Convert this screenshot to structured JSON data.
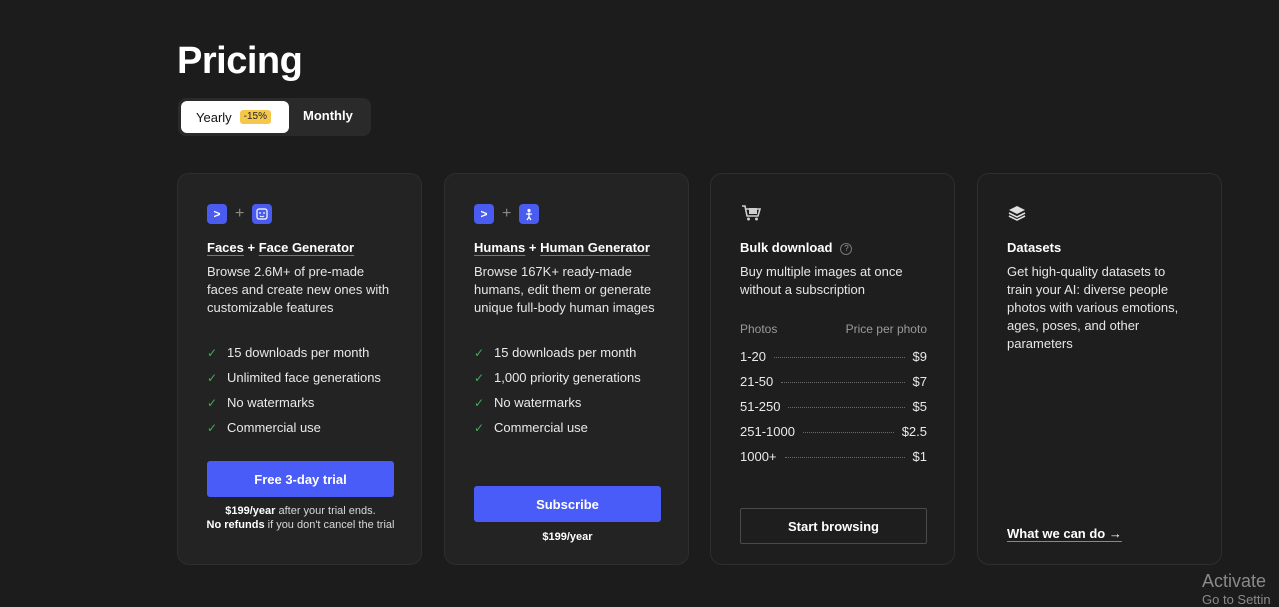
{
  "page": {
    "title": "Pricing"
  },
  "billing_toggle": {
    "yearly_label": "Yearly",
    "yearly_badge": "-15%",
    "monthly_label": "Monthly",
    "selected": "Yearly"
  },
  "cards": {
    "faces": {
      "icon1": ">",
      "icon2": "faces-generator-icon",
      "title_a": "Faces",
      "title_plus": " + ",
      "title_b": "Face Generator",
      "description": "Browse 2.6M+ of pre-made faces and create new ones with customizable features",
      "features": [
        "15 downloads per month",
        "Unlimited face generations",
        "No watermarks",
        "Commercial use"
      ],
      "button": "Free 3-day trial",
      "note_price": "$199/year",
      "note_text1": " after your trial ends.",
      "note_bold2": "No refunds",
      "note_text2": " if you don't cancel the trial"
    },
    "humans": {
      "icon1": ">",
      "icon2": "humans-generator-icon",
      "title_a": "Humans",
      "title_plus": " + ",
      "title_b": "Human Generator",
      "description": "Browse 167K+ ready-made humans, edit them or generate unique full-body human images",
      "features": [
        "15 downloads per month",
        "1,000 priority generations",
        "No watermarks",
        "Commercial use"
      ],
      "button": "Subscribe",
      "note_price": "$199/year"
    },
    "bulk": {
      "icon": "cart-icon",
      "title": "Bulk download",
      "help": "?",
      "description": "Buy multiple images at once without a subscription",
      "col_photos": "Photos",
      "col_price": "Price per photo",
      "rows": [
        {
          "range": "1-20",
          "price": "$9"
        },
        {
          "range": "21-50",
          "price": "$7"
        },
        {
          "range": "51-250",
          "price": "$5"
        },
        {
          "range": "251-1000",
          "price": "$2.5"
        },
        {
          "range": "1000+",
          "price": "$1"
        }
      ],
      "button": "Start browsing"
    },
    "datasets": {
      "icon": "layers-icon",
      "title": "Datasets",
      "description": "Get high-quality datasets to train your AI: diverse people photos with various emotions, ages, poses, and other parameters",
      "link": "What we can do →"
    }
  },
  "watermark": {
    "line1": "Activate",
    "line2": "Go to Settin"
  },
  "colors": {
    "accent": "#4a5cf8",
    "badge": "#f5c84c",
    "check": "#3fae5b",
    "background": "#1c1c1c"
  }
}
